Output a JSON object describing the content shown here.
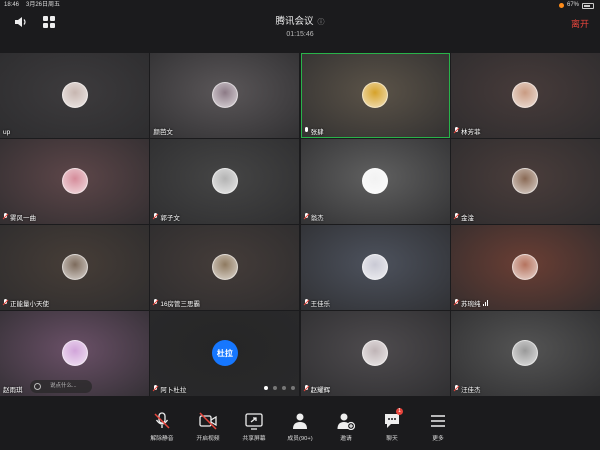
{
  "status_bar": {
    "time": "18:46",
    "date": "3月26日周五",
    "battery": "67%"
  },
  "header": {
    "title": "腾讯会议",
    "info_icon": "info-circle-icon",
    "duration": "01:15:46",
    "leave_label": "离开",
    "leave_color": "#e8453c"
  },
  "participants": [
    {
      "name": "up",
      "mic": "none",
      "bg": "#3d3b3d",
      "avatar": "#c7b6b0",
      "active": false
    },
    {
      "name": "颜芭文",
      "mic": "none",
      "bg": "#5a5658",
      "avatar": "#8c7a86",
      "active": false
    },
    {
      "name": "张肆",
      "mic": "on",
      "bg": "#5b5348",
      "avatar": "#d6a22a",
      "active": true
    },
    {
      "name": "林芳菲",
      "mic": "muted",
      "bg": "#473b3a",
      "avatar": "#c99b82",
      "active": false
    },
    {
      "name": "雾风一曲",
      "mic": "muted",
      "bg": "#5d4649",
      "avatar": "#d58c9a",
      "active": false
    },
    {
      "name": "郭子文",
      "mic": "muted",
      "bg": "#454545",
      "avatar": "#b3b3b3",
      "active": false
    },
    {
      "name": "翁杰",
      "mic": "muted",
      "bg": "#606060",
      "avatar": "#f2f2f2",
      "active": false
    },
    {
      "name": "金淦",
      "mic": "muted",
      "bg": "#4a3d3b",
      "avatar": "#8a6a55",
      "active": false
    },
    {
      "name": "正能量小天使",
      "mic": "muted",
      "bg": "#463d37",
      "avatar": "#7d6b5c",
      "active": false
    },
    {
      "name": "16房管三思霸",
      "mic": "muted",
      "bg": "#443c39",
      "avatar": "#8f7a60",
      "active": false
    },
    {
      "name": "王佳乐",
      "mic": "muted",
      "bg": "#4d525d",
      "avatar": "#c9c9d4",
      "active": false
    },
    {
      "name": "苏琬纯",
      "mic": "muted",
      "bg": "#6a3e34",
      "avatar": "#b5735e",
      "active": false,
      "signal": true
    },
    {
      "name": "赵雨琪",
      "mic": "none",
      "bg": "#6a5067",
      "avatar": "#d1a4d9",
      "active": false
    },
    {
      "name": "阿卜杜拉",
      "mic": "muted",
      "bg": "#262626",
      "avatar_text": "杜拉",
      "active": false
    },
    {
      "name": "赵耀辉",
      "mic": "muted",
      "bg": "#4e4b4e",
      "avatar": "#bfb4b6",
      "active": false
    },
    {
      "name": "汪佳杰",
      "mic": "muted",
      "bg": "#545454",
      "avatar": "#999999",
      "active": false
    }
  ],
  "chat_placeholder": "说点什么...",
  "toolbar": [
    {
      "label": "解除静音",
      "icon": "mic-off-icon"
    },
    {
      "label": "开启视频",
      "icon": "video-off-icon"
    },
    {
      "label": "共享屏幕",
      "icon": "share-screen-icon"
    },
    {
      "label": "成员(90+)",
      "icon": "members-icon"
    },
    {
      "label": "邀请",
      "icon": "invite-icon"
    },
    {
      "label": "聊天",
      "icon": "chat-icon",
      "badge": "1"
    },
    {
      "label": "更多",
      "icon": "more-icon"
    }
  ]
}
